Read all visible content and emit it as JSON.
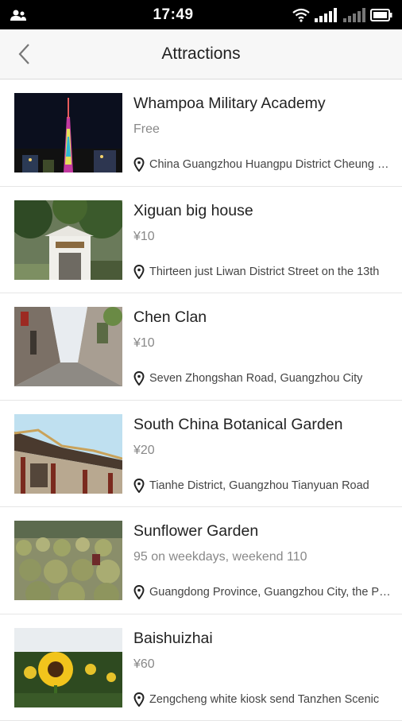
{
  "status_bar": {
    "time": "17:49"
  },
  "header": {
    "title": "Attractions"
  },
  "attractions": [
    {
      "name": "Whampoa Military Academy",
      "price": "Free",
      "address": "China Guangzhou Huangpu District Cheung Chau Island"
    },
    {
      "name": "Xiguan big house",
      "price": "¥10",
      "address": "Thirteen just Liwan District Street on the 13th"
    },
    {
      "name": "Chen Clan",
      "price": "¥10",
      "address": "Seven Zhongshan Road, Guangzhou City"
    },
    {
      "name": "South China Botanical Garden",
      "price": "¥20",
      "address": "Tianhe District, Guangzhou Tianyuan Road"
    },
    {
      "name": "Sunflower Garden",
      "price": "95 on weekdays, weekend 110",
      "address": "Guangdong Province, Guangzhou City, the Panyu"
    },
    {
      "name": "Baishuizhai",
      "price": "¥60",
      "address": "Zengcheng white kiosk send Tanzhen Scenic"
    }
  ]
}
